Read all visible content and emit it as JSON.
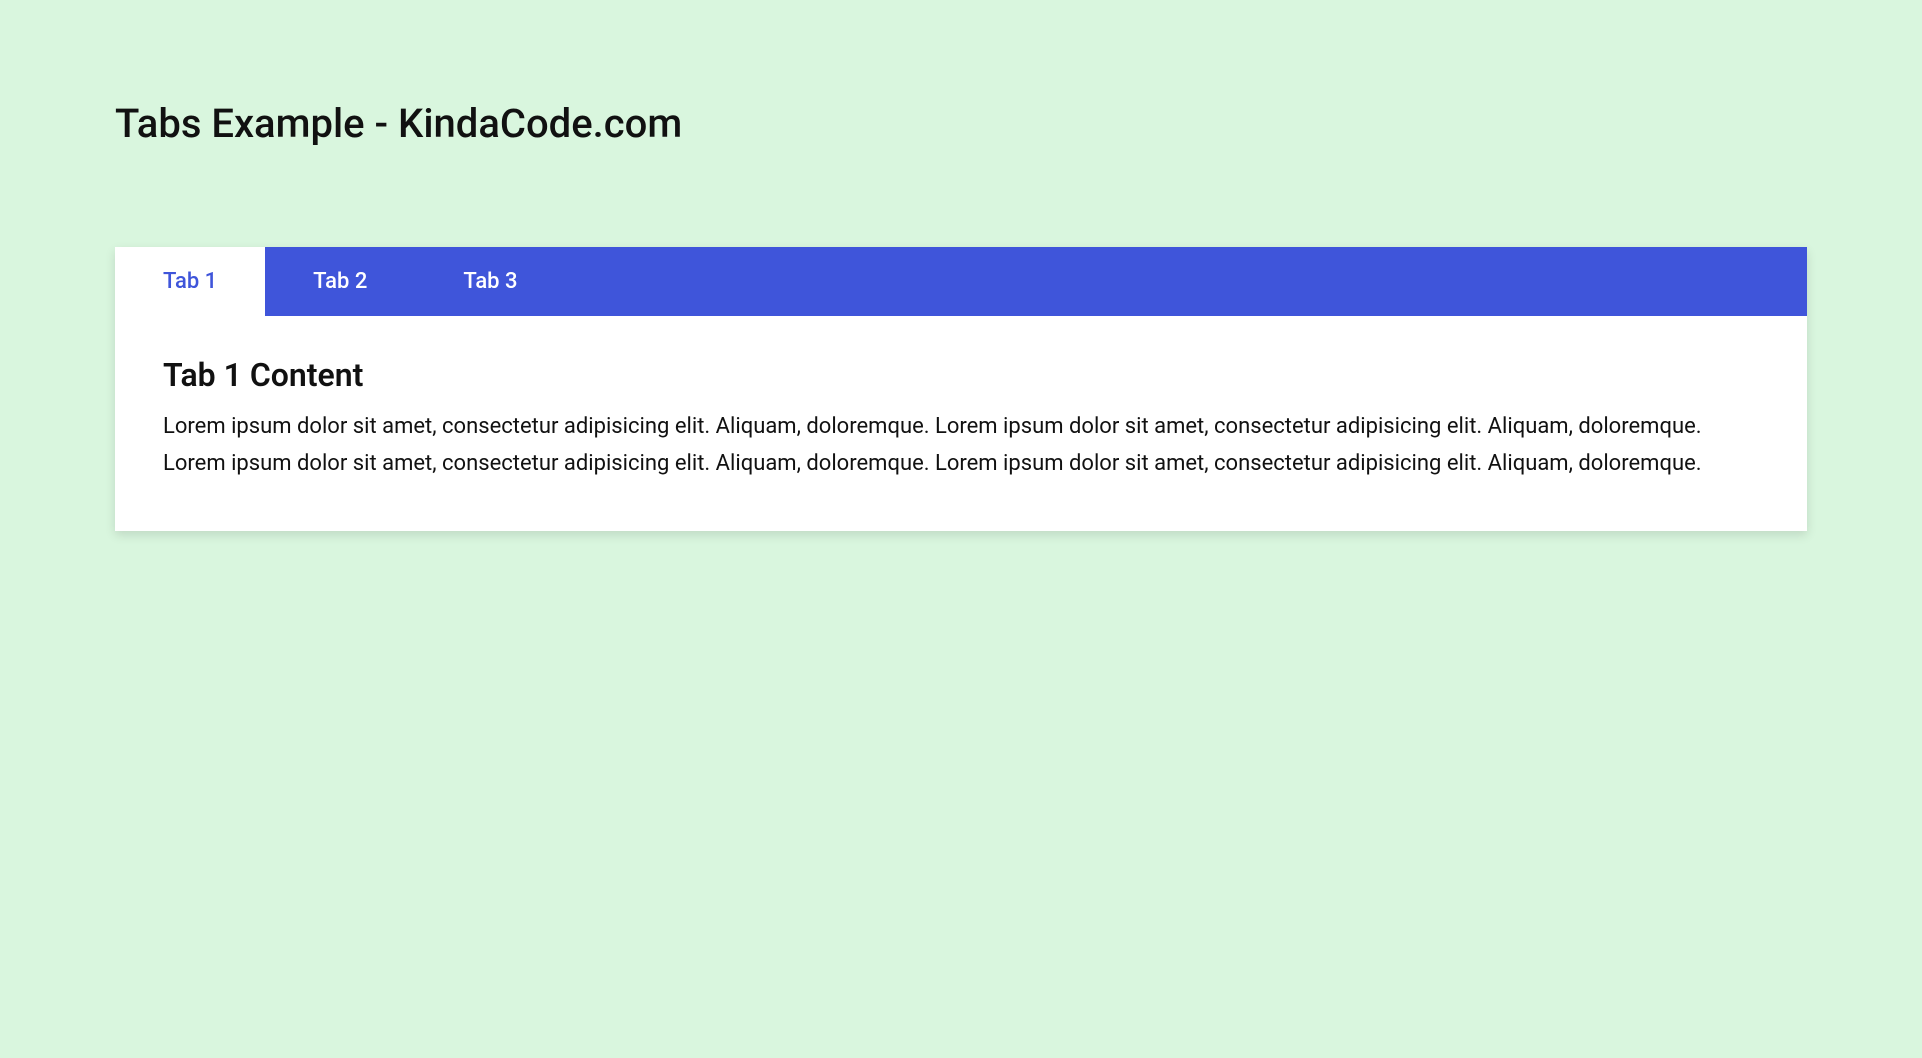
{
  "page": {
    "title": "Tabs Example - KindaCode.com"
  },
  "tabs": {
    "items": [
      {
        "label": "Tab 1",
        "active": true
      },
      {
        "label": "Tab 2",
        "active": false
      },
      {
        "label": "Tab 3",
        "active": false
      }
    ]
  },
  "content": {
    "heading": "Tab 1 Content",
    "paragraph": "Lorem ipsum dolor sit amet, consectetur adipisicing elit. Aliquam, doloremque. Lorem ipsum dolor sit amet, consectetur adipisicing elit. Aliquam, doloremque. Lorem ipsum dolor sit amet, consectetur adipisicing elit. Aliquam, doloremque. Lorem ipsum dolor sit amet, consectetur adipisicing elit. Aliquam, doloremque."
  },
  "colors": {
    "background": "#d9f6de",
    "accent": "#3f55da",
    "white": "#ffffff",
    "text": "#111111"
  }
}
